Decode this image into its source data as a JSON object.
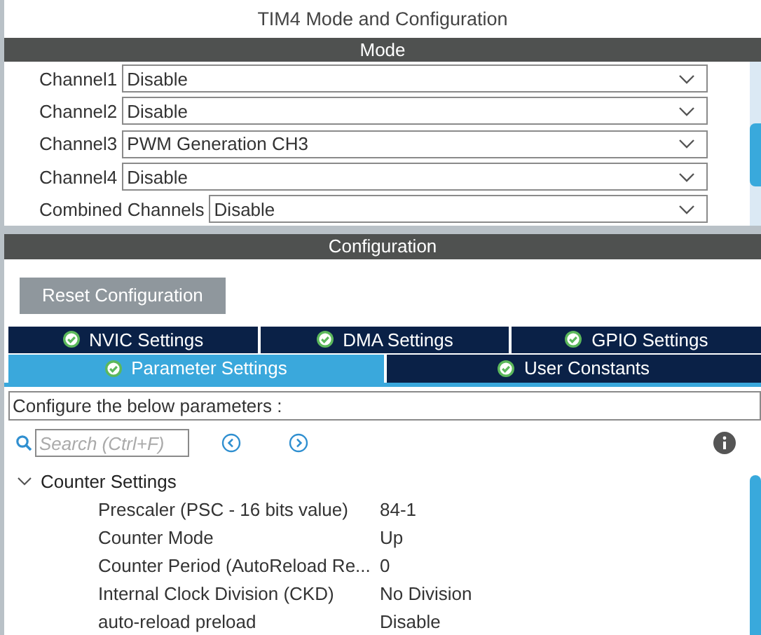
{
  "window": {
    "title": "TIM4 Mode and Configuration"
  },
  "mode": {
    "header": "Mode",
    "channels": [
      {
        "label": "Channel1",
        "value": "Disable"
      },
      {
        "label": "Channel2",
        "value": "Disable"
      },
      {
        "label": "Channel3",
        "value": "PWM Generation CH3"
      },
      {
        "label": "Channel4",
        "value": "Disable"
      },
      {
        "label": "Combined Channels",
        "value": "Disable"
      }
    ]
  },
  "configuration": {
    "header": "Configuration",
    "reset_button": "Reset Configuration",
    "tab_rows": [
      [
        {
          "label": "NVIC Settings",
          "selected": false
        },
        {
          "label": "DMA Settings",
          "selected": false
        },
        {
          "label": "GPIO Settings",
          "selected": false
        }
      ],
      [
        {
          "label": "Parameter Settings",
          "selected": true
        },
        {
          "label": "User Constants",
          "selected": false
        }
      ]
    ],
    "description": "Configure the below parameters :",
    "search": {
      "placeholder": "Search (Ctrl+F)"
    },
    "groups": [
      {
        "label": "Counter Settings",
        "expanded": true,
        "params": [
          {
            "name": "Prescaler (PSC - 16 bits value)",
            "value": "84-1"
          },
          {
            "name": "Counter Mode",
            "value": "Up"
          },
          {
            "name": "Counter Period (AutoReload Re...",
            "value": "0"
          },
          {
            "name": "Internal Clock Division (CKD)",
            "value": "No Division"
          },
          {
            "name": "auto-reload preload",
            "value": "Disable"
          }
        ]
      }
    ]
  }
}
